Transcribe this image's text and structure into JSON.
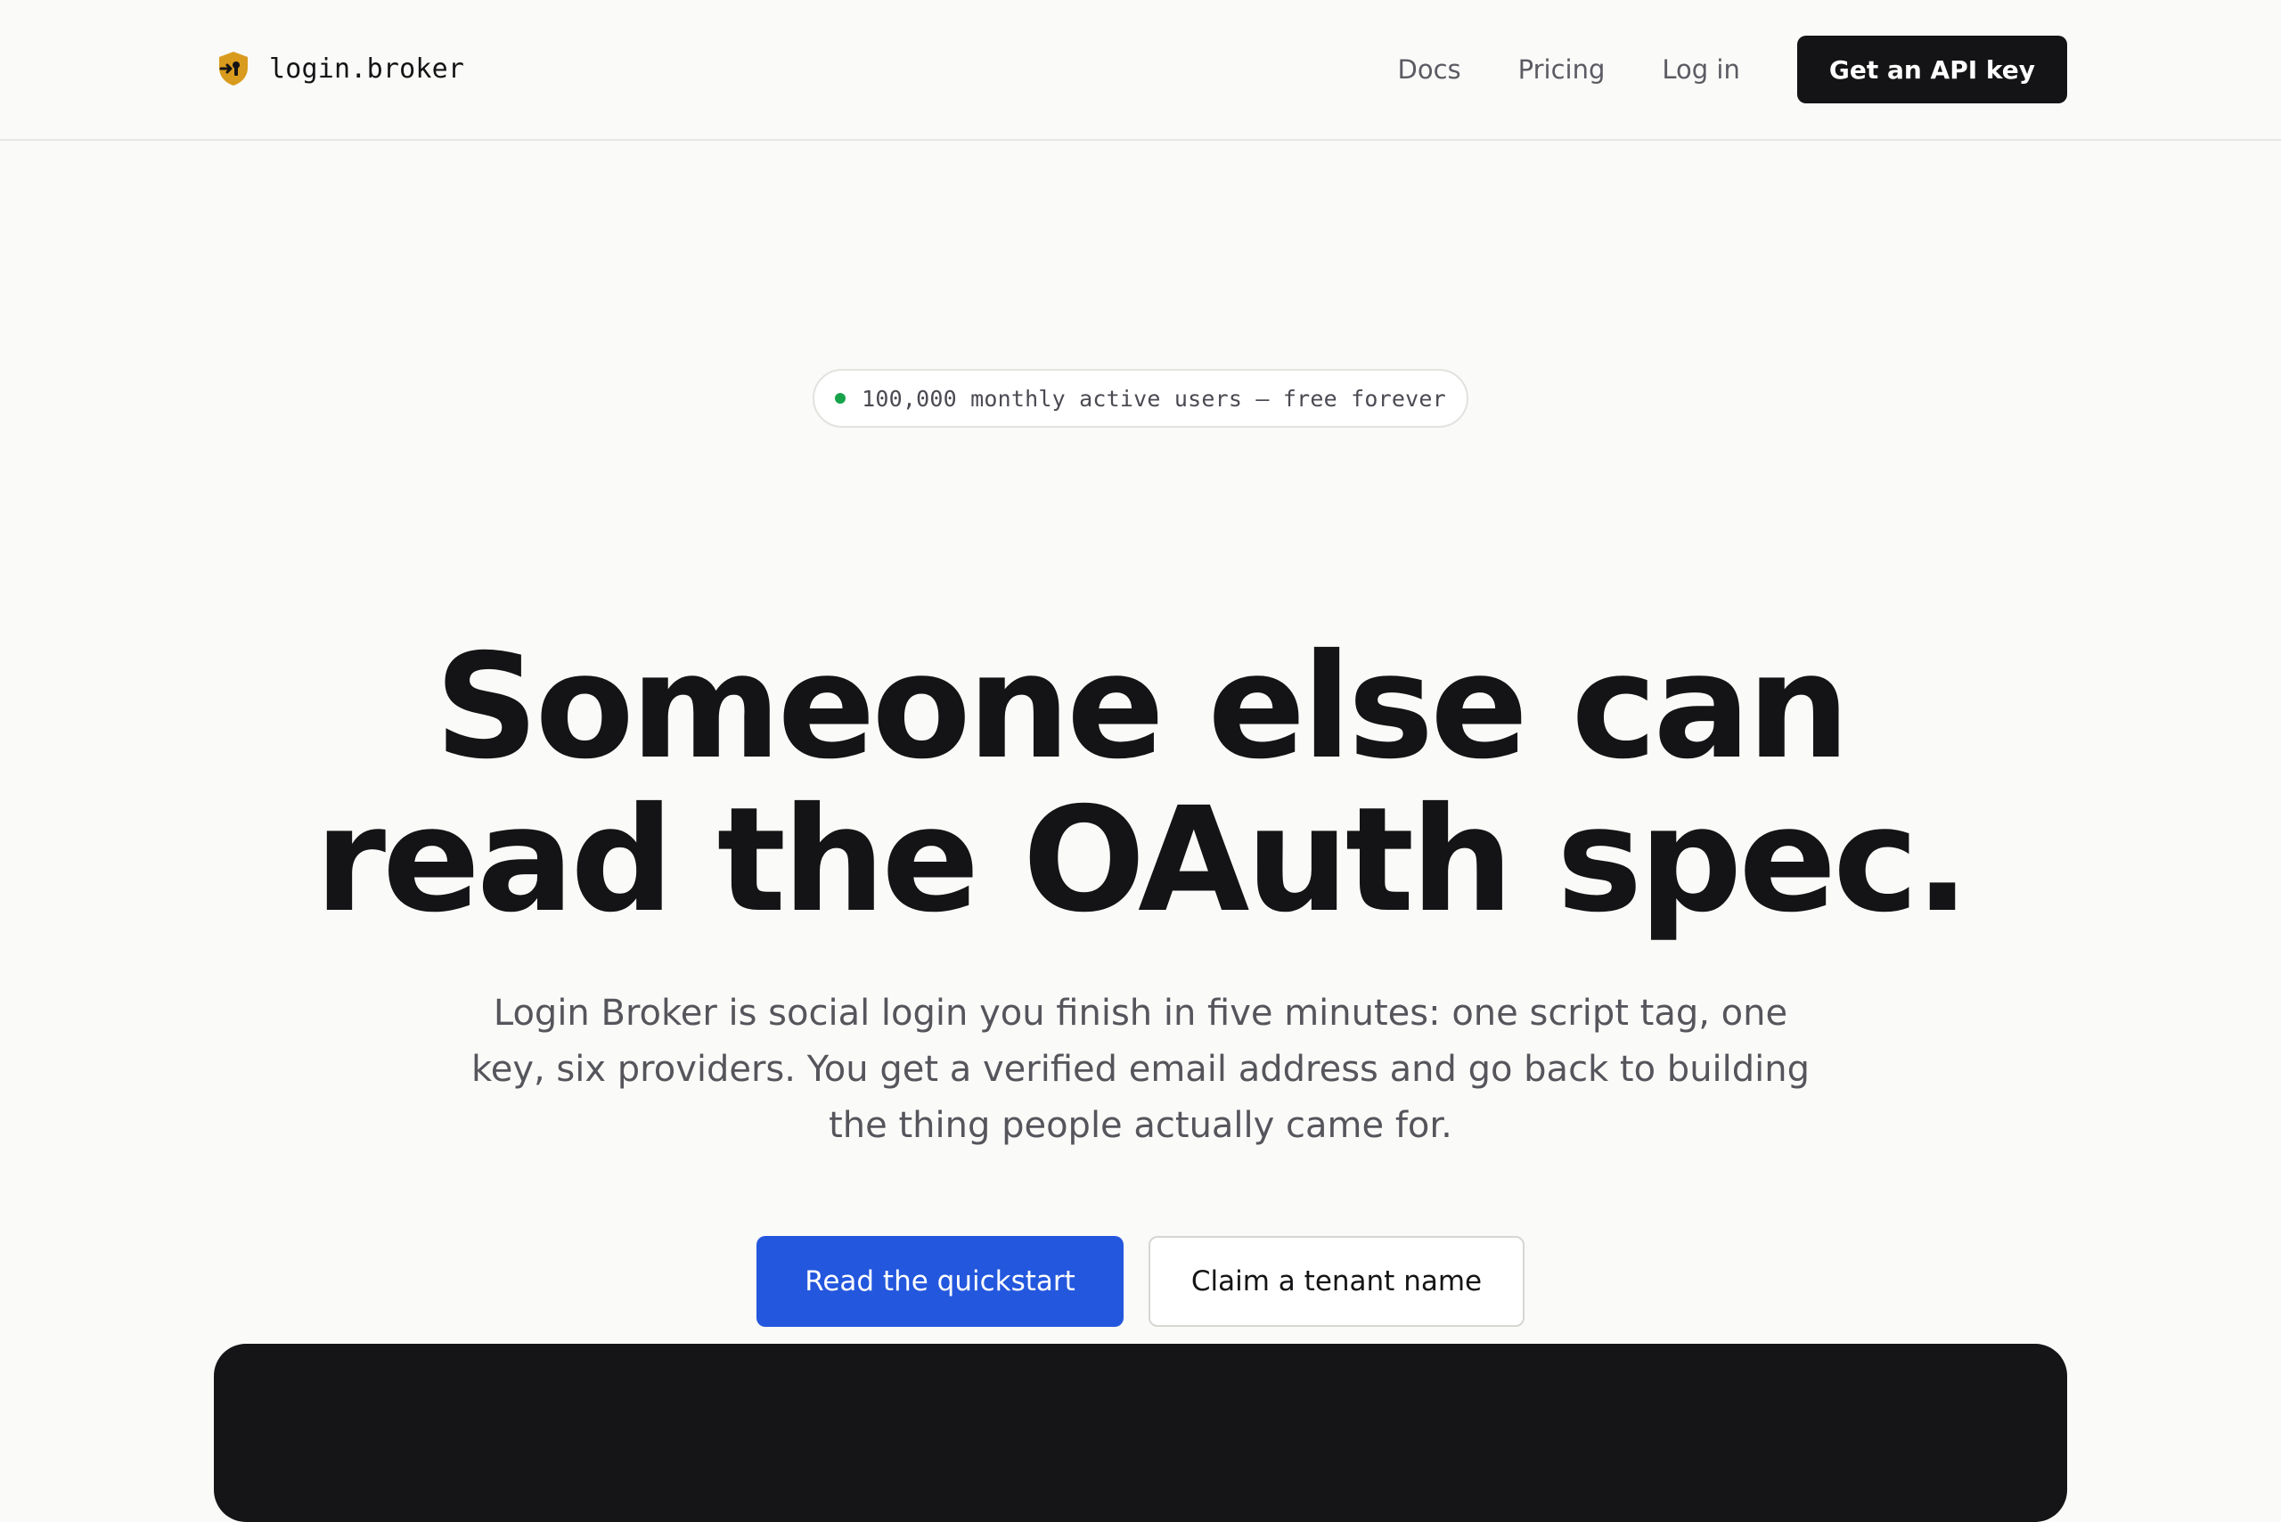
{
  "header": {
    "brand_name": "login.broker",
    "brand_icon": "shield-key-icon",
    "nav": {
      "docs": "Docs",
      "pricing": "Pricing",
      "login": "Log in",
      "cta": "Get an API key"
    }
  },
  "hero": {
    "badge": {
      "status_color": "#16a34a",
      "text": "100,000 monthly active users — free forever"
    },
    "headline_line1": "Someone else can",
    "headline_line2": "read the OAuth spec.",
    "subhead": "Login Broker is social login you finish in five minutes: one script tag, one key, six providers. You get a verified email address and go back to building the thing people actually came for.",
    "primary_cta": "Read the quickstart",
    "secondary_cta": "Claim a tenant name"
  },
  "colors": {
    "background": "#fafaf8",
    "text": "#141416",
    "accent": "#2357dd",
    "brand_icon": "#d99b1e"
  }
}
